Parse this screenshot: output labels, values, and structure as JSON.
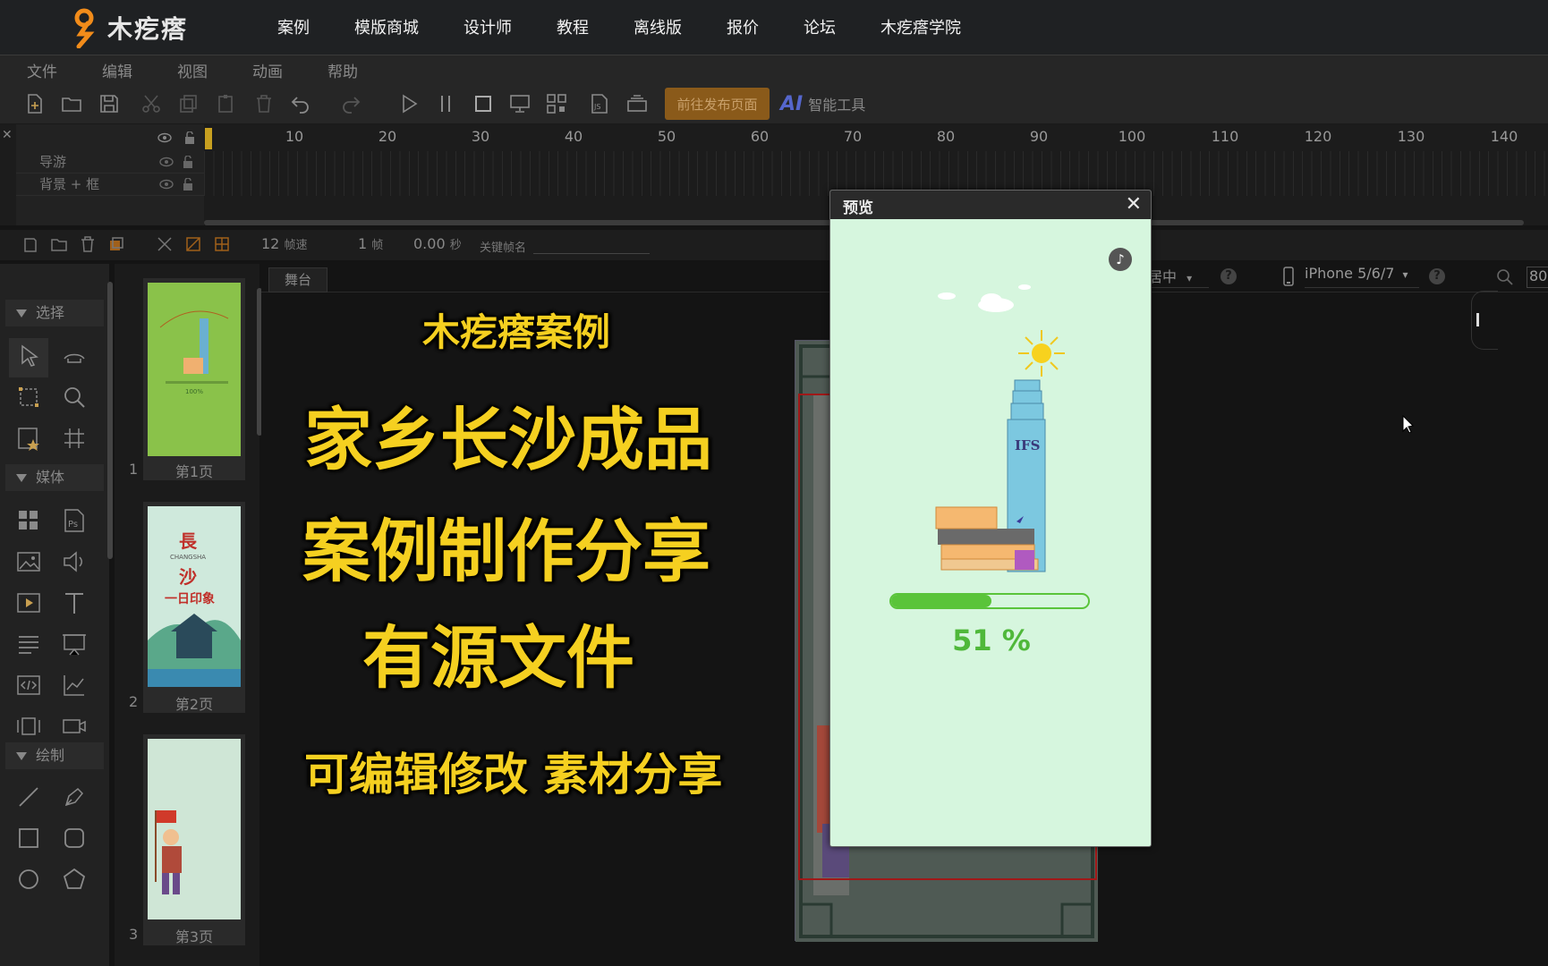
{
  "brand": {
    "name": "木疙瘩",
    "accent": "#f28c1a"
  },
  "topnav": {
    "items": [
      "案例",
      "模版商城",
      "设计师",
      "教程",
      "离线版",
      "报价",
      "论坛",
      "木疙瘩学院"
    ]
  },
  "menubar": {
    "items": [
      "文件",
      "编辑",
      "视图",
      "动画",
      "帮助"
    ]
  },
  "toolbar": {
    "publish_label": "前往发布页面",
    "ai_label": "智能工具",
    "icons": [
      "new-file-icon",
      "open-folder-icon",
      "save-icon",
      "cut-icon",
      "copy-icon",
      "paste-icon",
      "delete-icon",
      "undo-icon",
      "redo-icon",
      "play-icon",
      "pause-icon",
      "stop-icon",
      "preview-screen-icon",
      "qr-code-icon",
      "js-file-icon",
      "publish-stack-icon"
    ]
  },
  "timeline": {
    "layers": [
      "导游",
      "背景 + 框"
    ],
    "ruler_ticks": [
      "10",
      "20",
      "30",
      "40",
      "50",
      "60",
      "70",
      "80",
      "90",
      "100",
      "110",
      "120",
      "130",
      "140"
    ],
    "fps_value": "12",
    "fps_label": "帧速",
    "frame_value": "1",
    "frame_label": "帧",
    "time_value": "0.00",
    "time_label": "秒",
    "keyframe_label": "关键帧名"
  },
  "tools": {
    "sections": [
      "选择",
      "媒体",
      "绘制"
    ]
  },
  "pages": [
    {
      "number": "1",
      "label": "第1页"
    },
    {
      "number": "2",
      "label": "第2页",
      "thumb_title": "長",
      "thumb_sub": "CHANGSHA",
      "thumb_title2": "沙",
      "thumb_caption": "一日印象"
    },
    {
      "number": "3",
      "label": "第3页"
    }
  ],
  "stage": {
    "tab": "舞台",
    "align": "居中",
    "device": "iPhone 5/6/7",
    "zoom": "80"
  },
  "overlay": {
    "line1": "木疙瘩案例",
    "line2": "家乡长沙成品",
    "line3": "案例制作分享",
    "line4": "有源文件",
    "line5": "可编辑修改  素材分享"
  },
  "preview": {
    "title": "预览",
    "close": "✕",
    "music_icon": "♪",
    "building_label": "IFS",
    "progress_fraction": 0.51,
    "progress_text": "51  %",
    "accent": "#5ac43a",
    "background": "#d6f6de"
  }
}
